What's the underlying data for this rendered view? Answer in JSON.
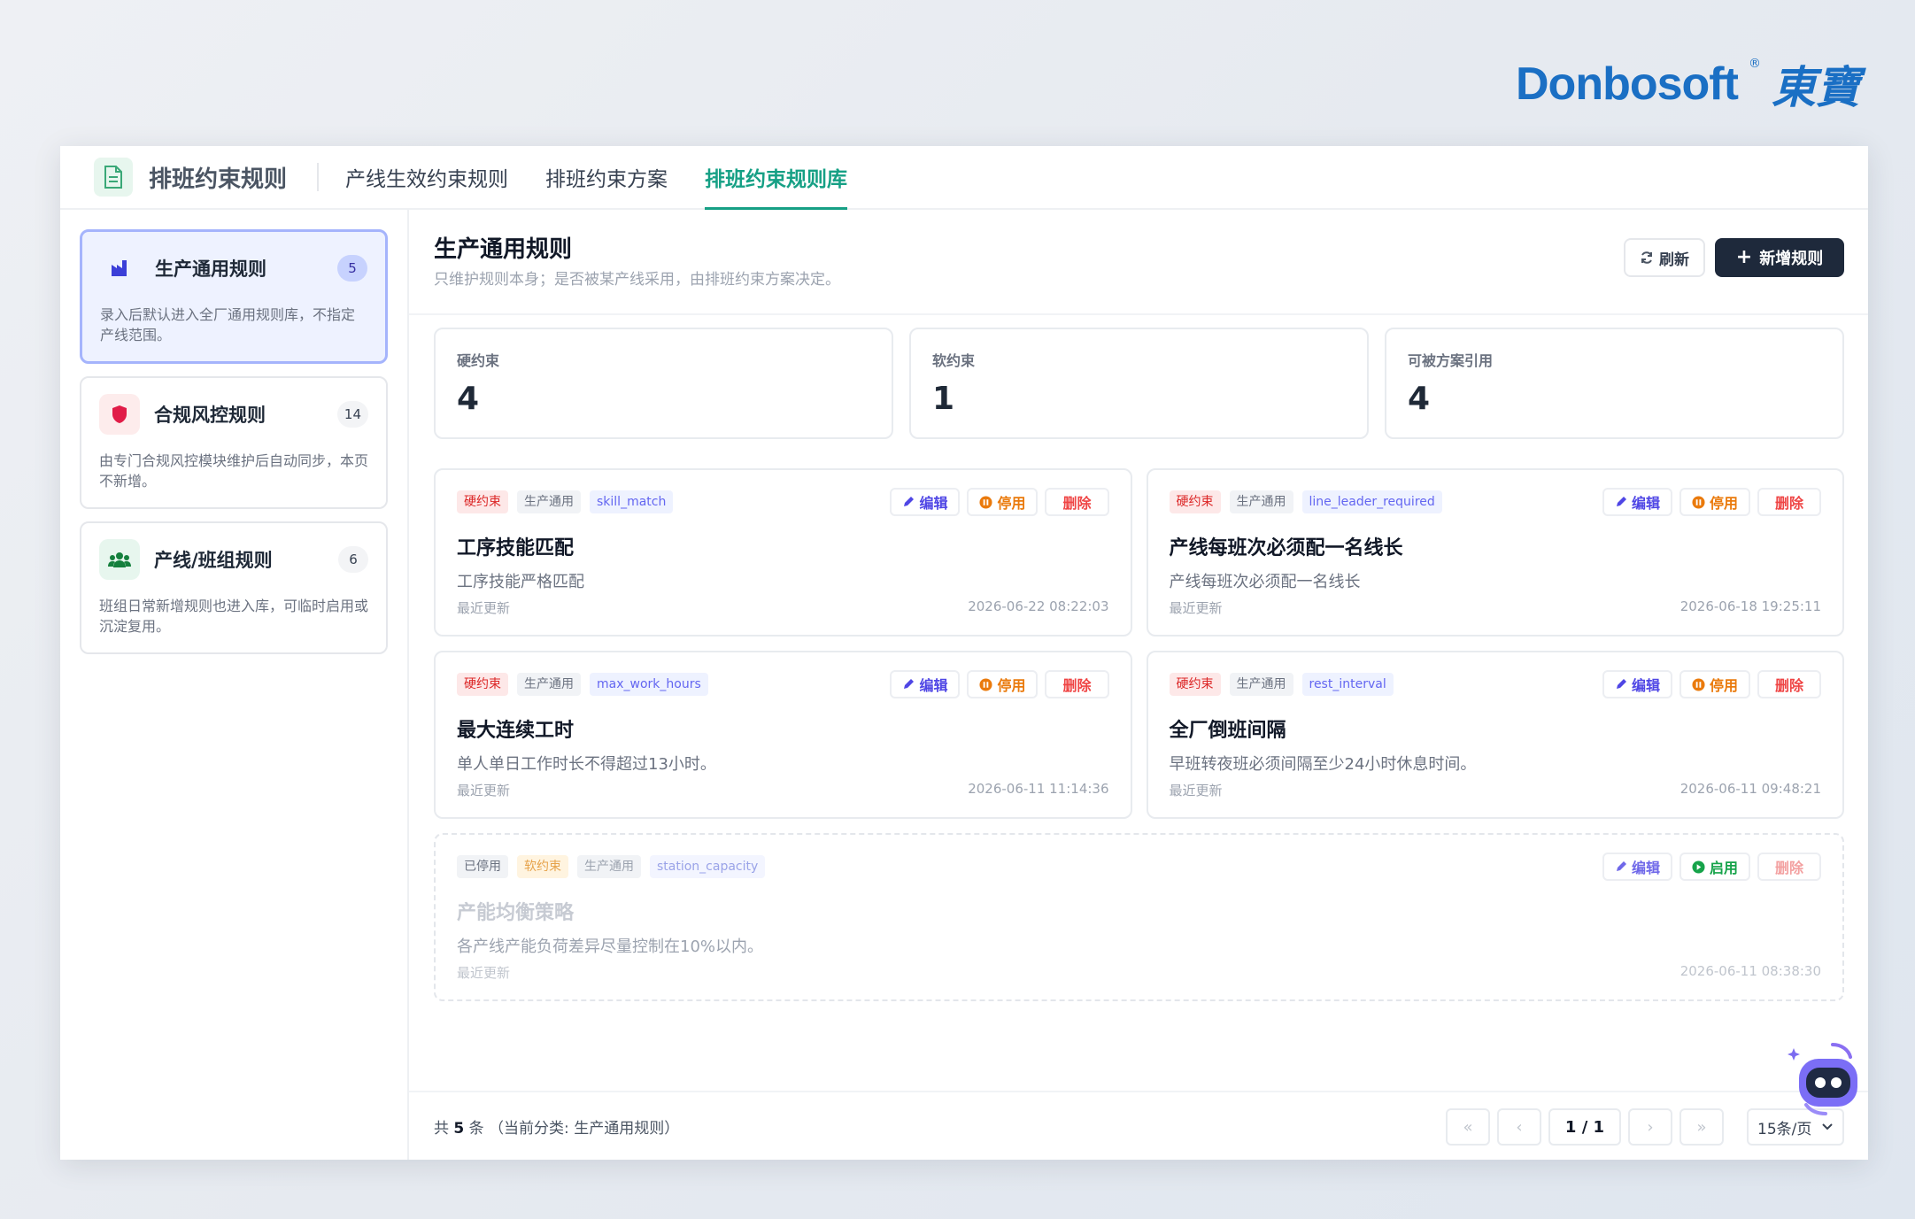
{
  "brand": {
    "word": "Donbosoft",
    "reg": "®",
    "cn": "東寶"
  },
  "header": {
    "app_title": "排班约束规则",
    "tabs": [
      {
        "label": "产线生效约束规则"
      },
      {
        "label": "排班约束方案"
      },
      {
        "label": "排班约束规则库"
      }
    ],
    "active_tab": 2
  },
  "sidebar": {
    "categories": [
      {
        "name": "生产通用规则",
        "count": "5",
        "desc": "录入后默认进入全厂通用规则库，不指定产线范围。",
        "icon": "factory-icon"
      },
      {
        "name": "合规风控规则",
        "count": "14",
        "desc": "由专门合规风控模块维护后自动同步，本页不新增。",
        "icon": "shield-icon"
      },
      {
        "name": "产线/班组规则",
        "count": "6",
        "desc": "班组日常新增规则也进入库，可临时启用或沉淀复用。",
        "icon": "team-icon"
      }
    ]
  },
  "main": {
    "title": "生产通用规则",
    "subtitle": "只维护规则本身；是否被某产线采用，由排班约束方案决定。",
    "refresh_label": "刷新",
    "new_label": "新增规则",
    "stats": [
      {
        "label": "硬约束",
        "value": "4"
      },
      {
        "label": "软约束",
        "value": "1"
      },
      {
        "label": "可被方案引用",
        "value": "4"
      }
    ],
    "action_labels": {
      "edit": "编辑",
      "stop": "停用",
      "start": "启用",
      "delete": "删除"
    },
    "updated_label": "最近更新",
    "rules": [
      {
        "type": "硬约束",
        "category": "生产通用",
        "code": "skill_match",
        "title": "工序技能匹配",
        "desc": "工序技能严格匹配",
        "updated": "2026-06-22 08:22:03"
      },
      {
        "type": "硬约束",
        "category": "生产通用",
        "code": "line_leader_required",
        "title": "产线每班次必须配一名线长",
        "desc": "产线每班次必须配一名线长",
        "updated": "2026-06-18 19:25:11"
      },
      {
        "type": "硬约束",
        "category": "生产通用",
        "code": "max_work_hours",
        "title": "最大连续工时",
        "desc": "单人单日工作时长不得超过13小时。",
        "updated": "2026-06-11 11:14:36"
      },
      {
        "type": "硬约束",
        "category": "生产通用",
        "code": "rest_interval",
        "title": "全厂倒班间隔",
        "desc": "早班转夜班必须间隔至少24小时休息时间。",
        "updated": "2026-06-11 09:48:21"
      }
    ],
    "disabled_rule": {
      "status": "已停用",
      "type": "软约束",
      "category": "生产通用",
      "code": "station_capacity",
      "title": "产能均衡策略",
      "desc": "各产线产能负荷差异尽量控制在10%以内。",
      "updated": "2026-06-11 08:38:30"
    }
  },
  "footer": {
    "total_prefix": "共",
    "total_count": "5",
    "total_suffix": "条 （当前分类: 生产通用规则）",
    "page": "1 / 1",
    "page_size": "15条/页"
  },
  "colors": {
    "accent": "#16a085",
    "primary_dark": "#1e293b",
    "danger": "#dc2626",
    "warning": "#ea7a0c",
    "brand": "#1a6fc4"
  }
}
